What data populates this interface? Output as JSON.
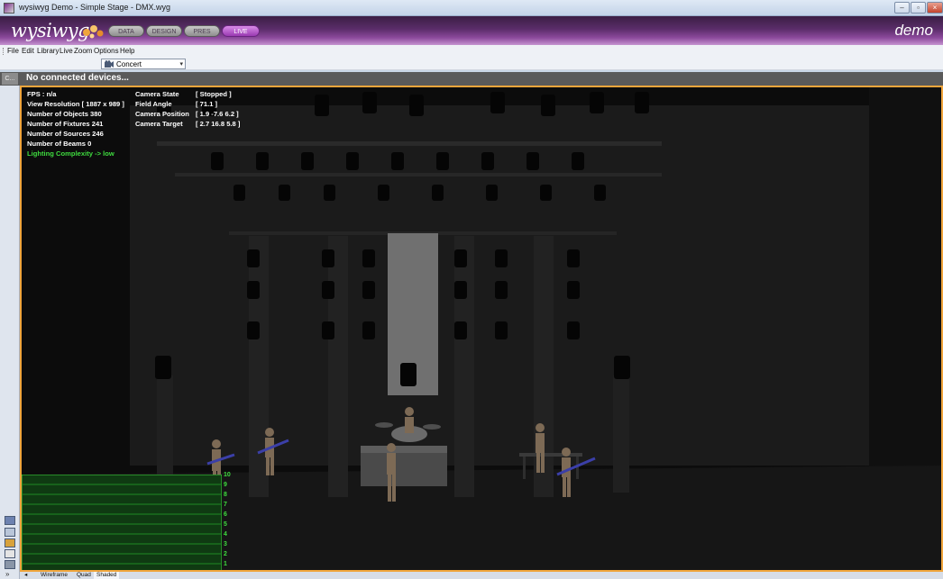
{
  "window": {
    "title": "wysiwyg Demo - Simple Stage - DMX.wyg",
    "controls": [
      "–",
      "▫",
      "×"
    ]
  },
  "header": {
    "logo": "wysiwyg",
    "modes": [
      {
        "label": "DATA",
        "active": false
      },
      {
        "label": "DESIGN",
        "active": false
      },
      {
        "label": "PRES",
        "active": false
      },
      {
        "label": "LIVE",
        "active": true
      }
    ],
    "edition": "demo"
  },
  "menu": {
    "items": [
      "File",
      "Edit",
      "Library",
      "Live",
      "Zoom",
      "Options",
      "Help"
    ]
  },
  "toolbar": {
    "scene_select": {
      "value": "Concert",
      "icon": "scene-icon"
    }
  },
  "status": {
    "side_tag": "C...",
    "message": "No connected devices..."
  },
  "hud": {
    "left": [
      {
        "text": "FPS : n/a",
        "highlight": false
      },
      {
        "text": "View Resolution [ 1887 x 989 ]",
        "highlight": false
      },
      {
        "text": "Number of Objects 380",
        "highlight": false
      },
      {
        "text": "Number of Fixtures 241",
        "highlight": false
      },
      {
        "text": "Number of Sources 246",
        "highlight": false
      },
      {
        "text": "Number of Beams  0",
        "highlight": false
      },
      {
        "text": "Lighting Complexity -> low",
        "highlight": true
      }
    ],
    "camera_labels": [
      "Camera State",
      "Field Angle",
      "Camera Position",
      "Camera Target"
    ],
    "camera_values": [
      "[ Stopped ]",
      "[ 71.1 ]",
      "[ 1.9  -7.6  6.2 ]",
      "[ 2.7  16.8  5.8 ]"
    ]
  },
  "meter": {
    "levels": [
      "10",
      "9",
      "8",
      "7",
      "6",
      "5",
      "4",
      "3",
      "2",
      "1"
    ],
    "color": "#3fdc3f"
  },
  "view_tabs": [
    "Wireframe",
    "Quad",
    "Shaded"
  ],
  "colors": {
    "accent": "#f0a53c",
    "header_purple": "#5b2d6a",
    "live_tab": "#b560c8"
  }
}
